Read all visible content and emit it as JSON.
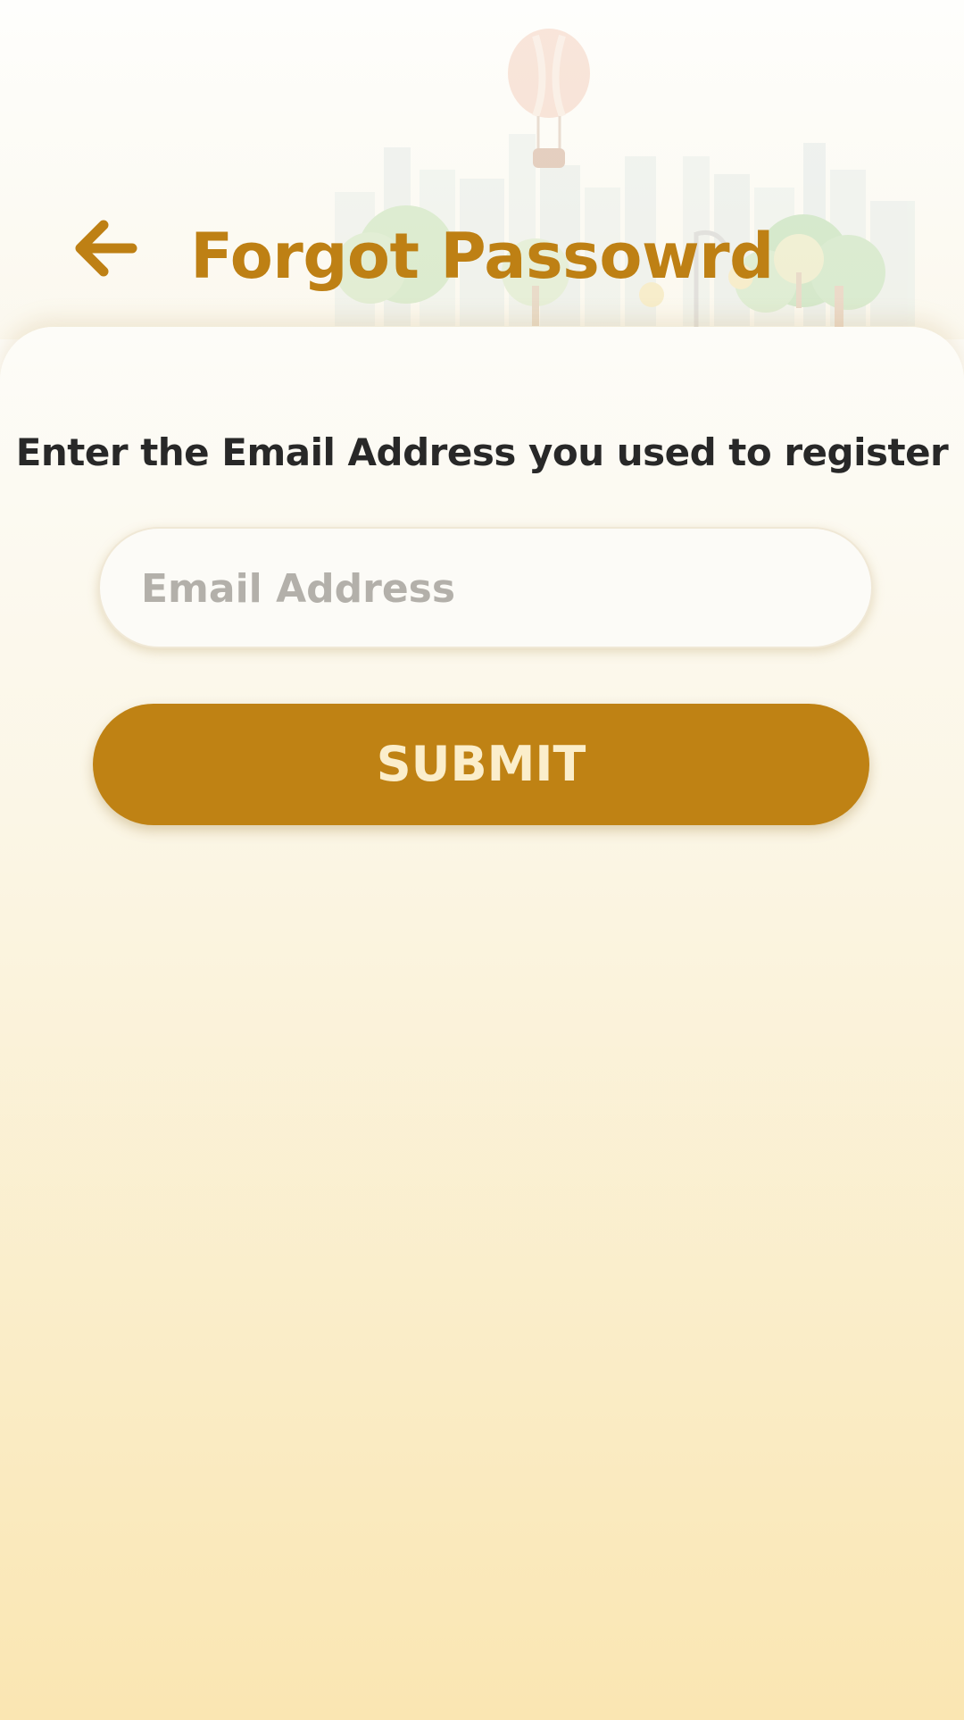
{
  "header": {
    "title": "Forgot Passowrd",
    "back_icon": "arrow-left-icon",
    "background_illustration": "city-skyline-illustration"
  },
  "form": {
    "prompt": "Enter the Email Address you used to register",
    "email_placeholder": "Email Address",
    "email_value": "",
    "submit_label": "SUBMIT"
  },
  "colors": {
    "accent": "#BF8214",
    "title": "#BE8014",
    "text": "#282828",
    "placeholder": "#B3B0AA",
    "button_text": "#FBEECB",
    "background_bottom": "#FAE6B2"
  }
}
